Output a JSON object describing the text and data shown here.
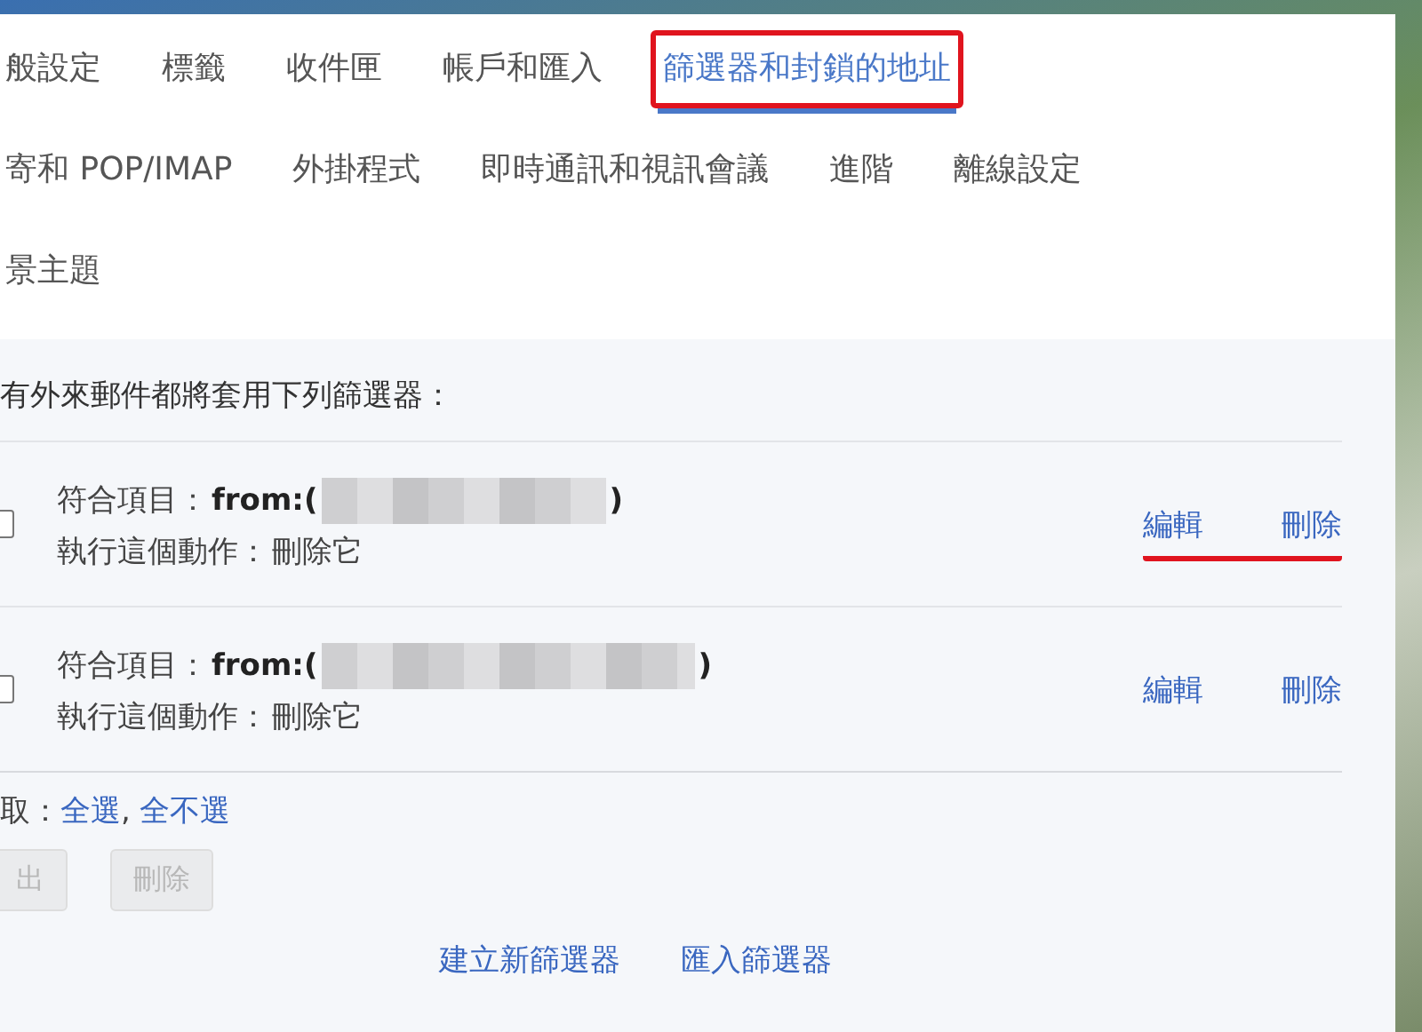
{
  "tab_rows": [
    [
      {
        "label": "般設定",
        "selected": false,
        "highlighted": false
      },
      {
        "label": "標籤",
        "selected": false,
        "highlighted": false
      },
      {
        "label": "收件匣",
        "selected": false,
        "highlighted": false
      },
      {
        "label": "帳戶和匯入",
        "selected": false,
        "highlighted": false
      },
      {
        "label": "篩選器和封鎖的地址",
        "selected": true,
        "highlighted": true
      }
    ],
    [
      {
        "label": "寄和 POP/IMAP",
        "selected": false,
        "highlighted": false
      },
      {
        "label": "外掛程式",
        "selected": false,
        "highlighted": false
      },
      {
        "label": "即時通訊和視訊會議",
        "selected": false,
        "highlighted": false
      },
      {
        "label": "進階",
        "selected": false,
        "highlighted": false
      },
      {
        "label": "離線設定",
        "selected": false,
        "highlighted": false
      }
    ],
    [
      {
        "label": "景主題",
        "selected": false,
        "highlighted": false
      }
    ]
  ],
  "filters": {
    "heading": "有外來郵件都將套用下列篩選器：",
    "items": [
      {
        "match_label": "符合項目：",
        "match_value": "from:(",
        "match_end": ")",
        "action_label": "執行這個動作：",
        "action_value": "刪除它",
        "checked": false,
        "edit": "編輯",
        "delete": "刪除",
        "actions_underlined": true
      },
      {
        "match_label": "符合項目：",
        "match_value": "from:(",
        "match_end": ")",
        "action_label": "執行這個動作：",
        "action_value": "刪除它",
        "checked": false,
        "edit": "編輯",
        "delete": "刪除",
        "actions_underlined": false
      }
    ],
    "select_label": "取：",
    "select_all": "全選",
    "separator": ",",
    "select_none": "全不選",
    "buttons": [
      {
        "label": "出",
        "disabled": true
      },
      {
        "label": "刪除",
        "disabled": true
      }
    ],
    "links": [
      "建立新篩選器",
      "匯入篩選器"
    ]
  }
}
